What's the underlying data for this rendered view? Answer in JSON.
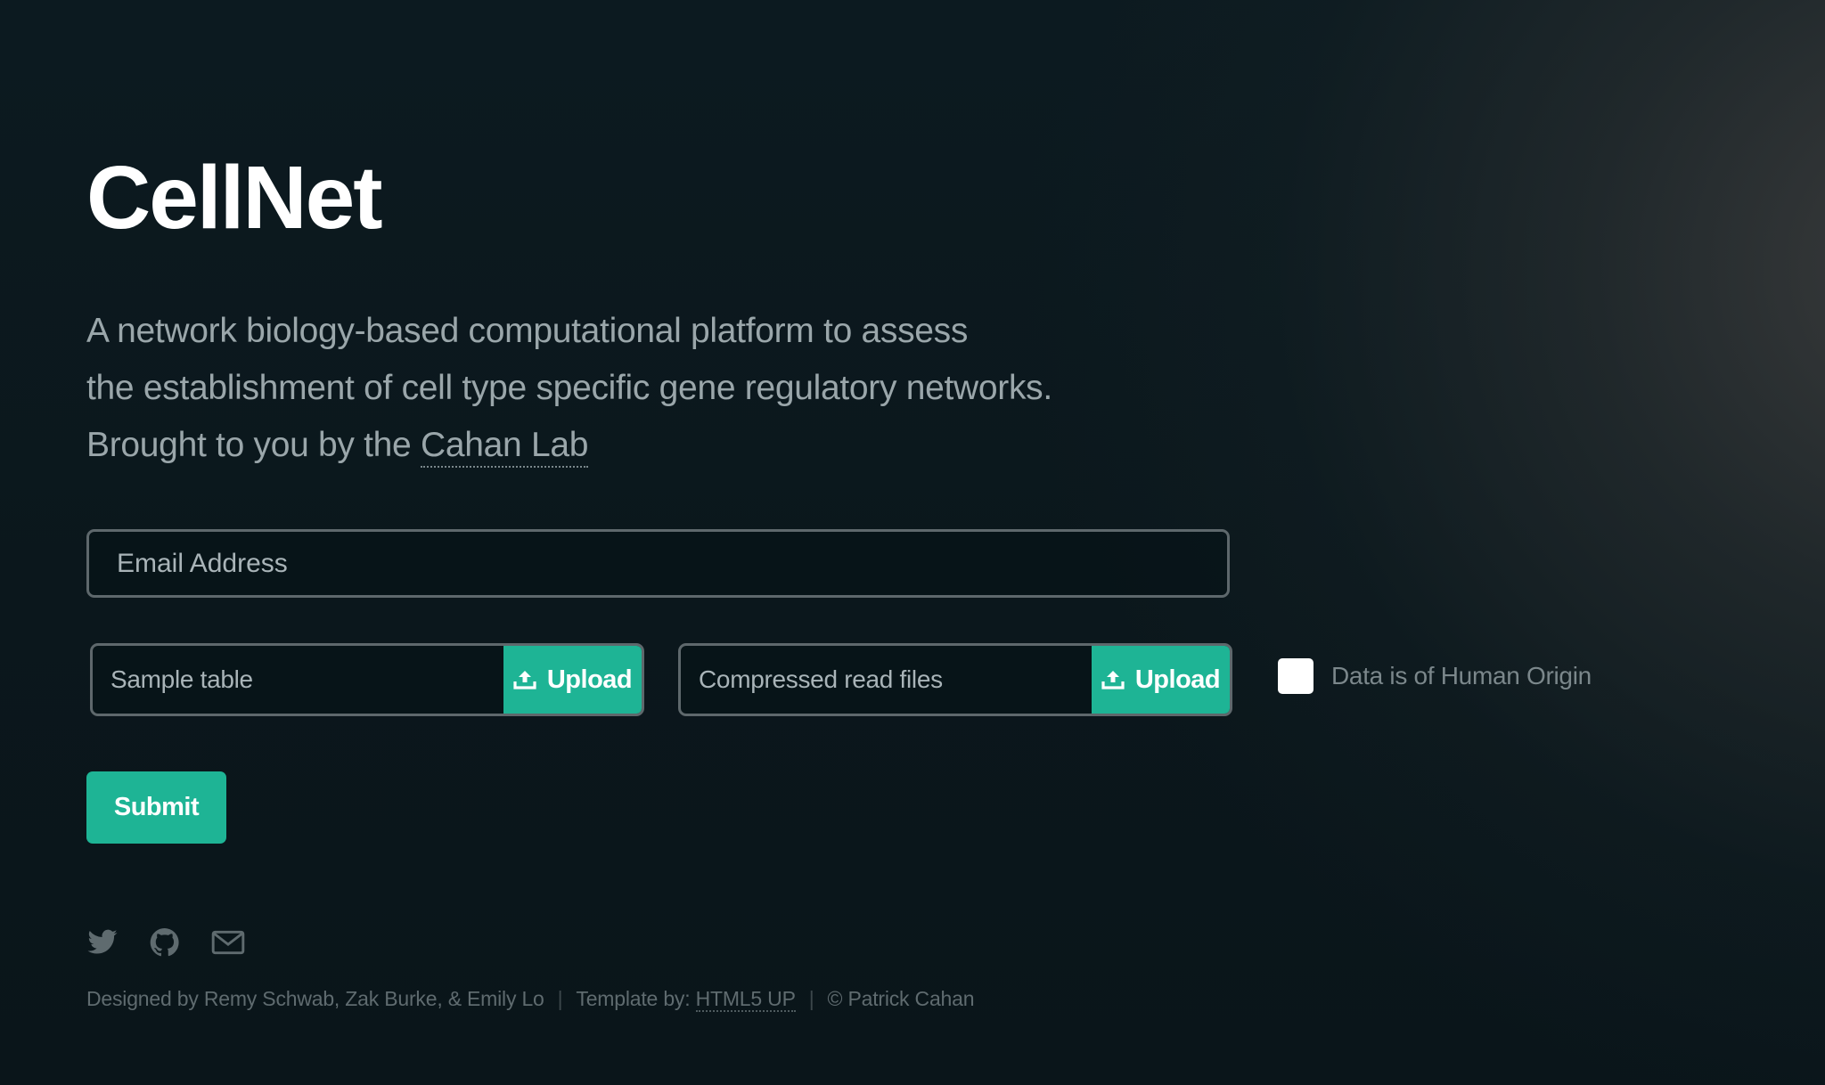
{
  "header": {
    "title": "CellNet"
  },
  "tagline": {
    "line1": "A network biology-based computational platform to assess",
    "line2": "the establishment of cell type specific gene regulatory networks.",
    "line3_prefix": "Brought to you by the ",
    "lab_link": "Cahan Lab"
  },
  "form": {
    "email_placeholder": "Email Address",
    "sample_table_label": "Sample table",
    "compressed_files_label": "Compressed read files",
    "upload_label": "Upload",
    "human_origin_label": "Data is of Human Origin",
    "human_origin_checked": false,
    "submit_label": "Submit"
  },
  "social": {
    "icons": [
      "twitter-icon",
      "github-icon",
      "mail-icon"
    ],
    "icon_color": "#5f6b6f"
  },
  "footer": {
    "designed_by": "Designed by Remy Schwab, Zak Burke, & Emily Lo",
    "template_prefix": "Template by: ",
    "template_link": "HTML5 UP",
    "copyright": "© Patrick Cahan"
  },
  "colors": {
    "accent": "#1eb495",
    "background": "#0b171c",
    "text_muted": "#9aa6aa"
  }
}
